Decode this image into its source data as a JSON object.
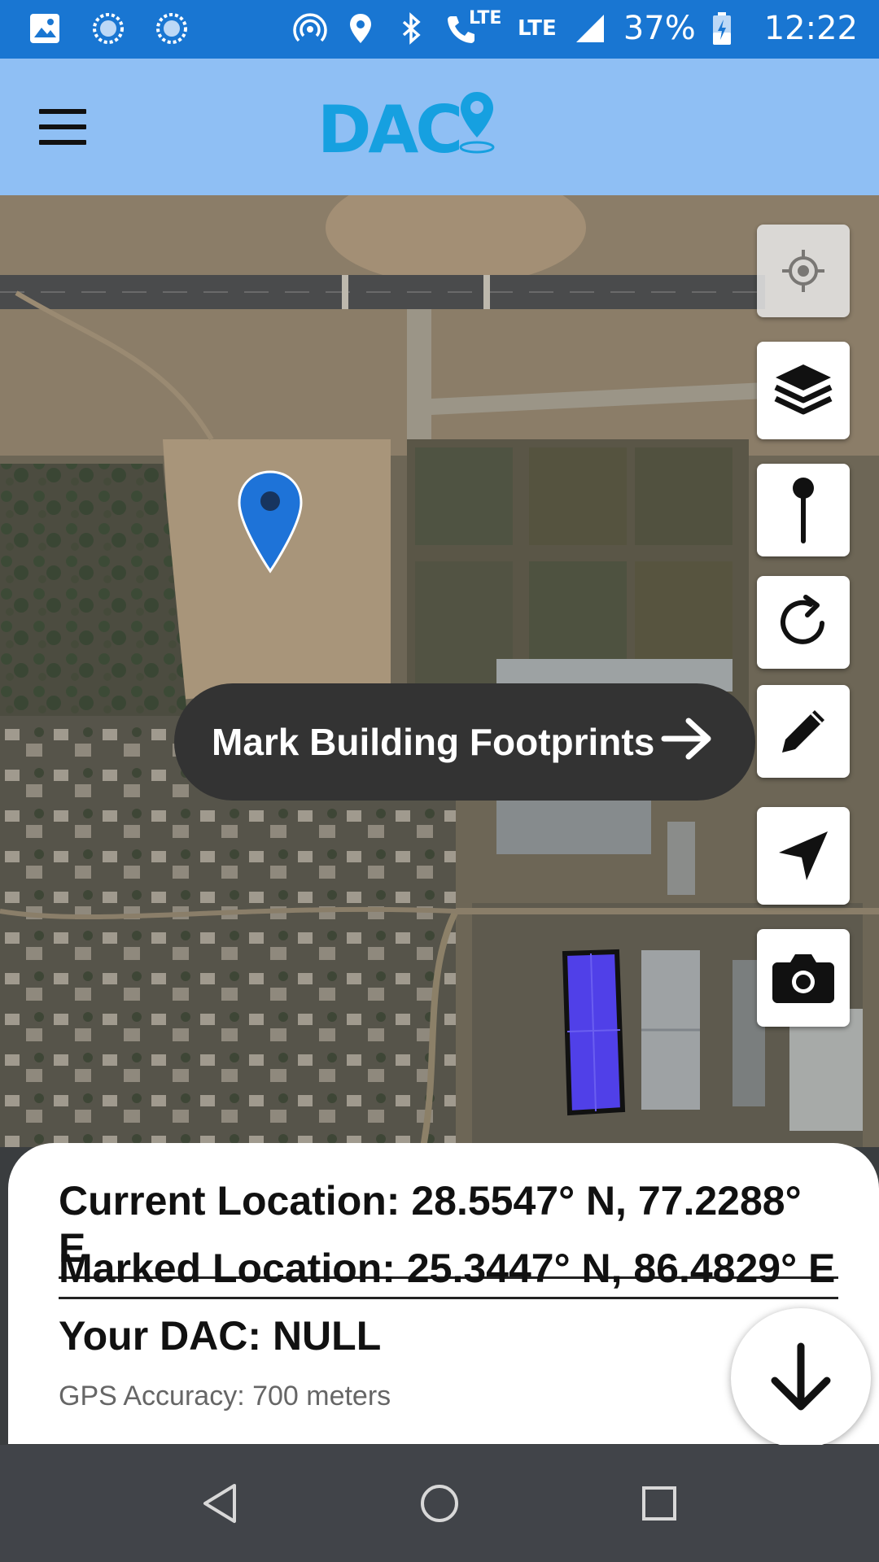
{
  "status_bar": {
    "lte_small": "LTE",
    "lte": "LTE",
    "battery": "37%",
    "time": "12:22"
  },
  "app": {
    "logo_text": "DAC"
  },
  "map": {
    "banner_label": "Mark Building Footprints",
    "controls": [
      "gps-target-icon",
      "layers-icon",
      "marker-icon",
      "refresh-icon",
      "pencil-icon",
      "navigation-icon",
      "camera-icon"
    ]
  },
  "info": {
    "current_location": "Current Location: 28.5547° N, 77.2288° E",
    "marked_location": "Marked Location: 25.3447° N, 86.4829° E",
    "your_dac": "Your DAC: NULL",
    "gps_accuracy": "GPS Accuracy: 700 meters"
  },
  "colors": {
    "status_bar": "#1976d2",
    "app_bar": "#8fbff4",
    "logo": "#16a0e0",
    "pin": "#1e73d8",
    "footprint": "#5040e8",
    "banner": "#333333",
    "nav_bar": "#414449"
  }
}
